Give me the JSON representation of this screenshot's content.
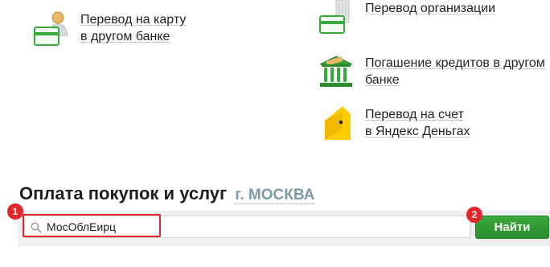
{
  "transfers": {
    "card_other_bank": {
      "line1": "Перевод на карту",
      "line2": "в другом банке"
    },
    "organization": {
      "line1": "Перевод организации"
    },
    "loan_repayment": {
      "line1": "Погашение кредитов в другом",
      "line2": "банке"
    },
    "yandex_money": {
      "line1": "Перевод на счет",
      "line2": "в Яндекс Деньгах"
    }
  },
  "payments": {
    "title": "Оплата покупок и услуг",
    "city": "г. МОСКВА",
    "search_value": "МосОблЕирц",
    "find_label": "Найти"
  },
  "annotations": {
    "badge_1": "1",
    "badge_2": "2"
  },
  "colors": {
    "accent_green": "#2a8c2e",
    "highlight_red": "#e3262b",
    "city_link": "#7a9aa6"
  }
}
